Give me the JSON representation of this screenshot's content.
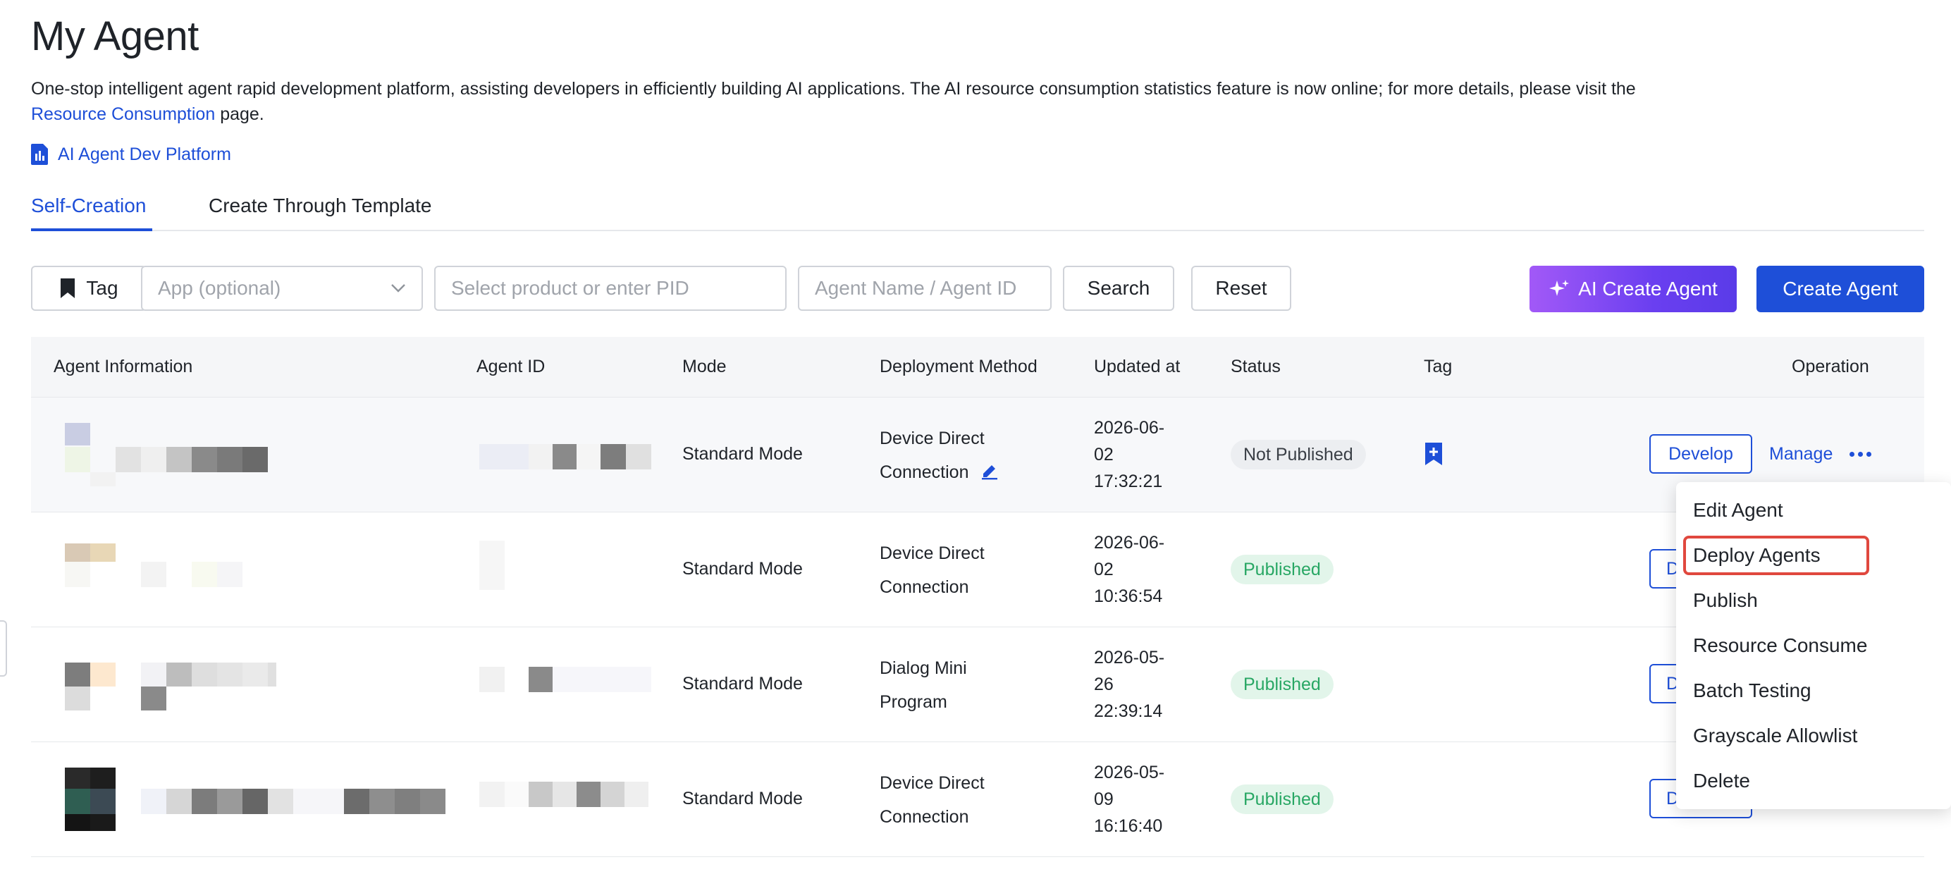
{
  "page": {
    "title": "My Agent",
    "description_main": "One-stop intelligent agent rapid development platform, assisting developers in efficiently building AI applications. The AI resource consumption statistics feature is now online; for more details, please visit the",
    "description_link": "Resource Consumption",
    "description_tail": " page.",
    "platform_link": "AI Agent Dev Platform"
  },
  "tabs": [
    {
      "label": "Self-Creation",
      "active": true
    },
    {
      "label": "Create Through Template",
      "active": false
    }
  ],
  "filters": {
    "tag_label": "Tag",
    "app_placeholder": "App (optional)",
    "pid_placeholder": "Select product or enter PID",
    "name_placeholder": "Agent Name / Agent ID",
    "search_label": "Search",
    "reset_label": "Reset",
    "ai_create_label": "AI Create Agent",
    "create_label": "Create Agent"
  },
  "table": {
    "headers": {
      "info": "Agent Information",
      "id": "Agent ID",
      "mode": "Mode",
      "deploy": "Deployment Method",
      "updated": "Updated at",
      "status": "Status",
      "tag": "Tag",
      "operation": "Operation"
    },
    "rows": [
      {
        "mode": "Standard Mode",
        "deploy_l1": "Device Direct",
        "deploy_l2": "Connection",
        "date_l1": "2026-06-",
        "date_l2": "02",
        "date_l3": "17:32:21",
        "status": "Not Published",
        "develop": "Develop",
        "manage": "Manage"
      },
      {
        "mode": "Standard Mode",
        "deploy_l1": "Device Direct",
        "deploy_l2": "Connection",
        "date_l1": "2026-06-",
        "date_l2": "02",
        "date_l3": "10:36:54",
        "status": "Published",
        "develop": "D"
      },
      {
        "mode": "Standard Mode",
        "deploy_l1": "Dialog Mini",
        "deploy_l2": "Program",
        "date_l1": "2026-05-",
        "date_l2": "26",
        "date_l3": "22:39:14",
        "status": "Published",
        "develop": "D"
      },
      {
        "mode": "Standard Mode",
        "deploy_l1": "Device Direct",
        "deploy_l2": "Connection",
        "date_l1": "2026-05-",
        "date_l2": "09",
        "date_l3": "16:16:40",
        "status": "Published",
        "develop": "D"
      }
    ]
  },
  "dropdown": {
    "items": [
      "Edit Agent",
      "Deploy Agents",
      "Publish",
      "Resource Consume",
      "Batch Testing",
      "Grayscale Allowlist",
      "Delete"
    ],
    "highlighted": "Deploy Agents"
  },
  "colors": {
    "accent": "#1e4fd8",
    "published_bg": "#e2f5ea",
    "published_text": "#28a764",
    "not_published_bg": "#eceef1",
    "highlight_border": "#e0483e"
  }
}
